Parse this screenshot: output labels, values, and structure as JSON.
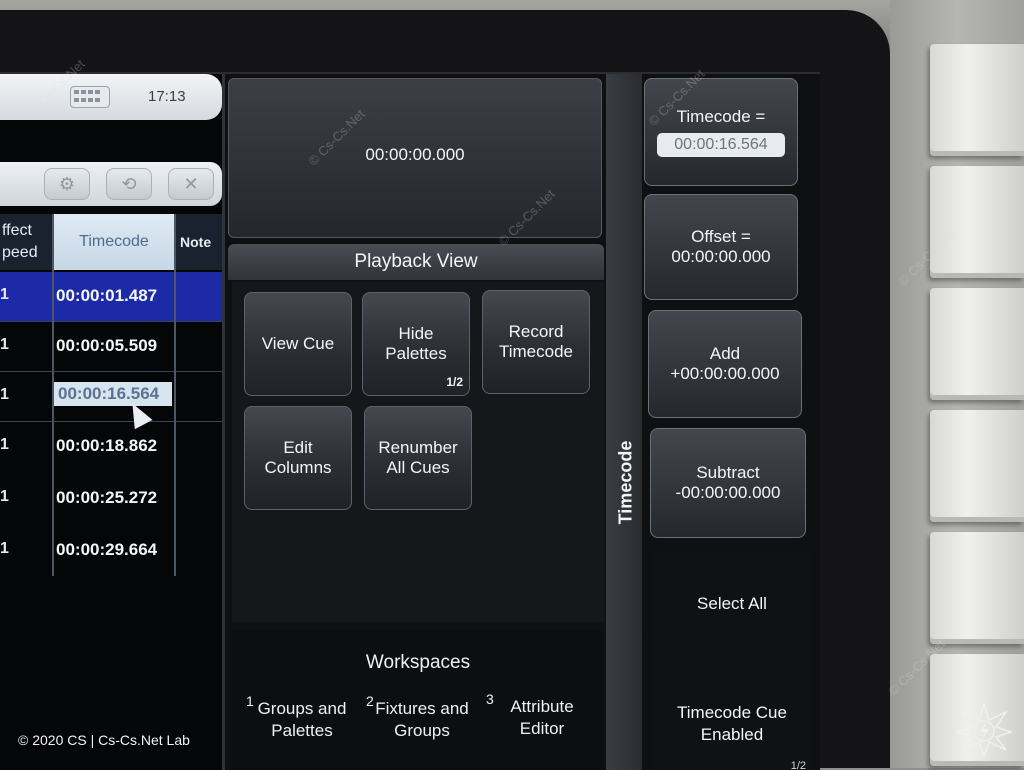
{
  "status_bar": {
    "clock": "17:13",
    "keyboard_icon": "keyboard-icon"
  },
  "toolbar": {
    "icons": [
      "gear-icon",
      "refresh-icon",
      "close-icon"
    ]
  },
  "cue_list": {
    "columns": {
      "effect_speed_line1": "ffect",
      "effect_speed_line2": "peed",
      "timecode": "Timecode",
      "note": "Note"
    },
    "rows": [
      {
        "c1": "1",
        "timecode": "00:00:01.487",
        "state": "selected"
      },
      {
        "c1": "1",
        "timecode": "00:00:05.509",
        "state": ""
      },
      {
        "c1": "1",
        "timecode": "00:00:16.564",
        "state": "current"
      },
      {
        "c1": "1",
        "timecode": "00:00:18.862",
        "state": ""
      },
      {
        "c1": "1",
        "timecode": "00:00:25.272",
        "state": ""
      },
      {
        "c1": "1",
        "timecode": "00:00:29.664",
        "state": ""
      }
    ]
  },
  "timecode_display": "00:00:00.000",
  "playback_view": {
    "title": "Playback View",
    "buttons": {
      "view_cue": "View Cue",
      "hide_palettes_1": "Hide",
      "hide_palettes_2": "Palettes",
      "hide_palettes_page": "1/2",
      "record_timecode_1": "Record",
      "record_timecode_2": "Timecode",
      "edit_columns_1": "Edit",
      "edit_columns_2": "Columns",
      "renumber_1": "Renumber",
      "renumber_2": "All Cues"
    }
  },
  "workspaces": {
    "title": "Workspaces",
    "items": [
      {
        "num": "1",
        "line1": "Groups and",
        "line2": "Palettes"
      },
      {
        "num": "2",
        "line1": "Fixtures and",
        "line2": "Groups"
      },
      {
        "num": "3",
        "line1": "Attribute",
        "line2": "Editor"
      }
    ]
  },
  "timecode_tab": "Timecode",
  "right_panel": {
    "timecode_label": "Timecode =",
    "timecode_value": "00:00:16.564",
    "offset_label": "Offset =",
    "offset_value": "00:00:00.000",
    "add_label": "Add",
    "add_value": "+00:00:00.000",
    "subtract_label": "Subtract",
    "subtract_value": "-00:00:00.000",
    "select_all": "Select All",
    "tc_cue_1": "Timecode Cue",
    "tc_cue_2": "Enabled",
    "page": "1/2"
  },
  "watermark": "© Cs-Cs.Net",
  "footer": "© 2020 CS | Cs-Cs.Net Lab"
}
